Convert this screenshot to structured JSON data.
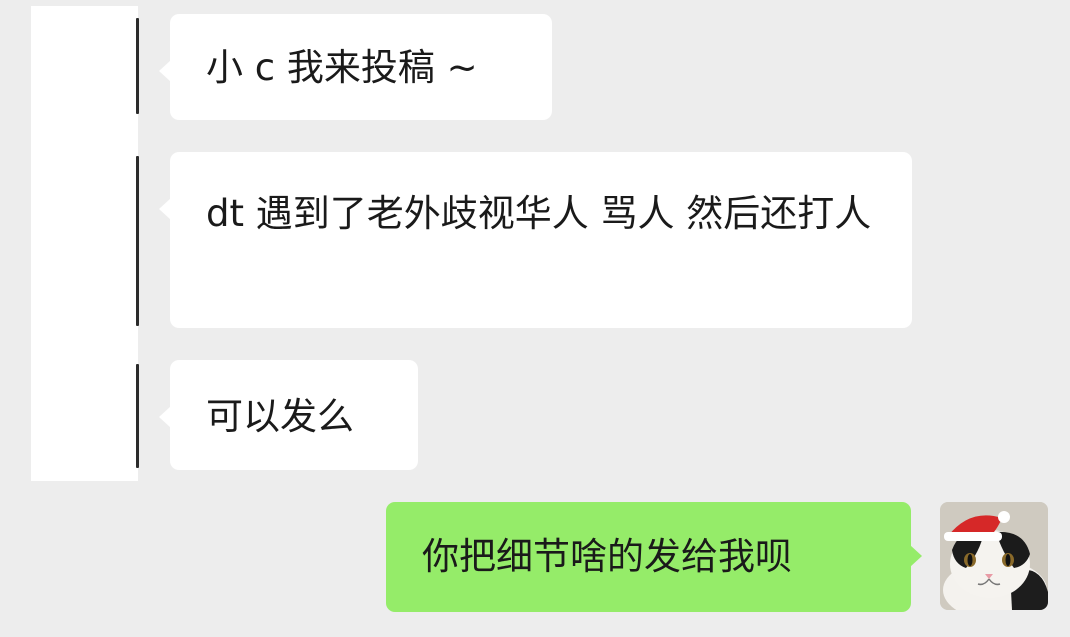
{
  "chat": {
    "messages": [
      {
        "direction": "incoming",
        "text": "小 c 我来投稿 ~"
      },
      {
        "direction": "incoming",
        "text": "dt 遇到了老外歧视华人 骂人 然后还打人"
      },
      {
        "direction": "incoming",
        "text": "可以发么"
      },
      {
        "direction": "outgoing",
        "text": "你把细节啥的发给我呗"
      }
    ]
  },
  "avatars": {
    "sender": {
      "icon": "redacted-avatar"
    },
    "self": {
      "icon": "cat-with-santa-hat-icon"
    }
  },
  "colors": {
    "background": "#ededed",
    "incoming_bubble": "#ffffff",
    "outgoing_bubble": "#95ec69",
    "text": "#1a1a1a"
  }
}
